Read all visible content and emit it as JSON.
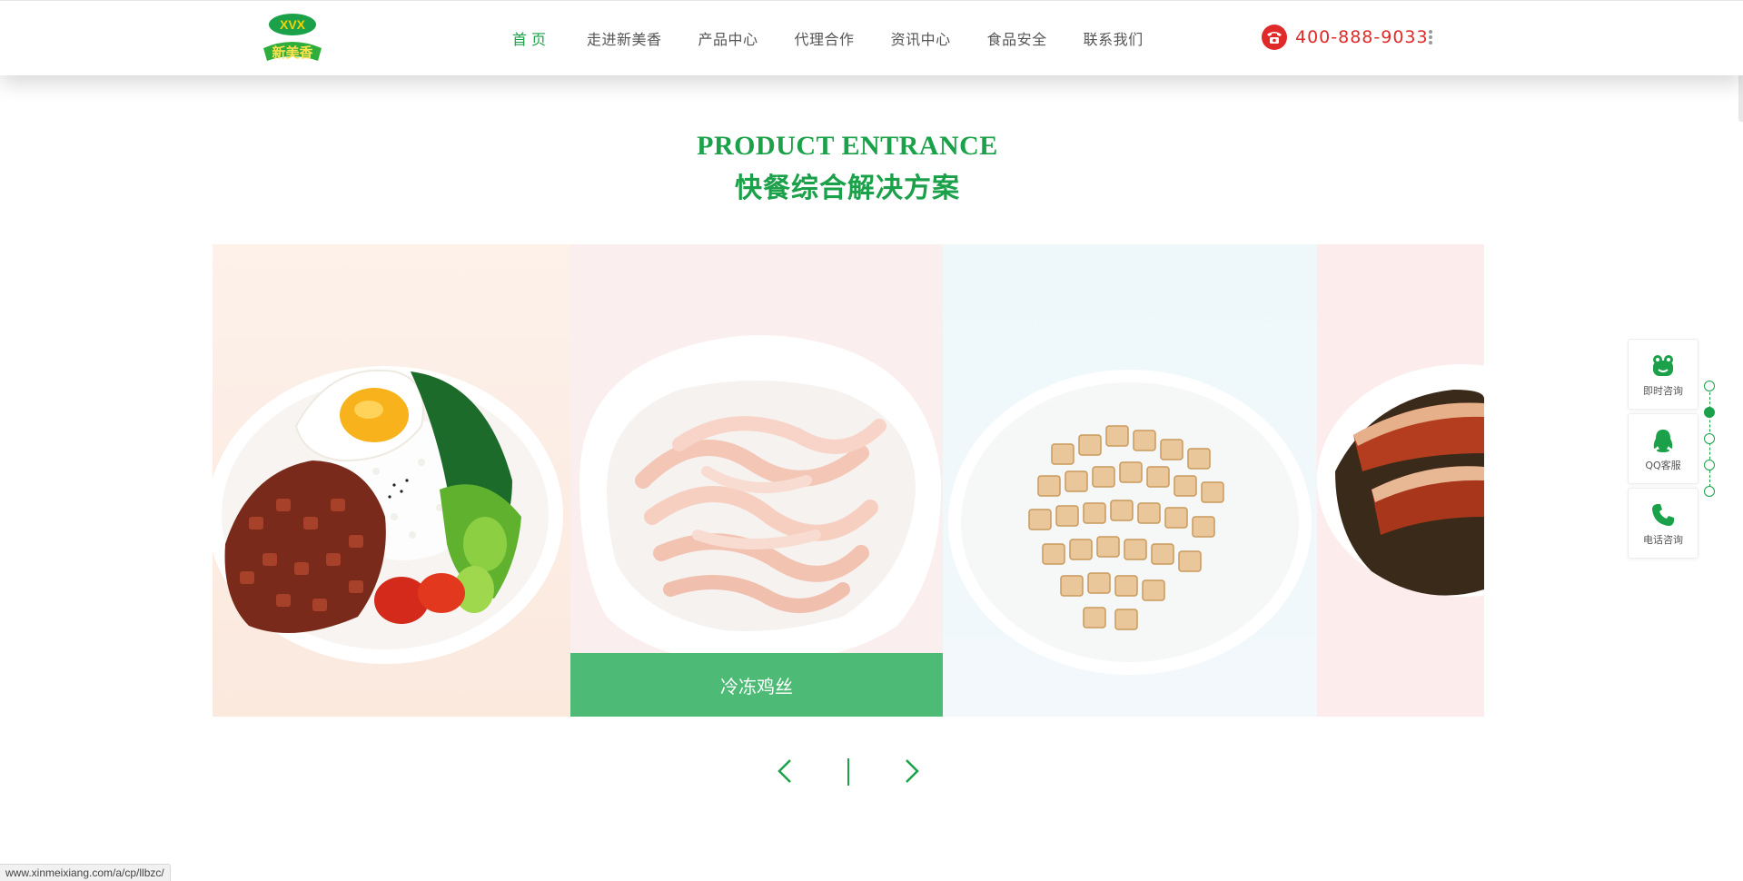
{
  "header": {
    "logo_text": "新美香",
    "nav": [
      {
        "label": "首页"
      },
      {
        "label": "走进新美香"
      },
      {
        "label": "产品中心"
      },
      {
        "label": "代理合作"
      },
      {
        "label": "资讯中心"
      },
      {
        "label": "食品安全"
      },
      {
        "label": "联系我们"
      }
    ],
    "phone": "400-888-9033"
  },
  "section": {
    "title_en": "PRODUCT ENTRANCE",
    "title_cn": "快餐综合解决方案"
  },
  "carousel": {
    "active_caption": "冷冻鸡丝",
    "slides": [
      {
        "image": "braised-pork-rice-with-egg-and-greens"
      },
      {
        "image": "frozen-shredded-chicken"
      },
      {
        "image": "diced-tofu-cubes"
      },
      {
        "image": "braised-pork-belly-with-preserved-greens"
      }
    ]
  },
  "service_panel": {
    "items": [
      {
        "label": "即时咨询",
        "icon": "chat-frog-icon"
      },
      {
        "label": "QQ客服",
        "icon": "qq-penguin-icon"
      },
      {
        "label": "电话咨询",
        "icon": "phone-icon"
      }
    ],
    "dot_count": 5,
    "active_dot": 1
  },
  "status_bar": {
    "url": "www.xinmeixiang.com/a/cp/llbzc/"
  },
  "colors": {
    "brand_green": "#1aa149",
    "caption_green": "#4dbb76",
    "phone_red": "#e02a2a"
  }
}
